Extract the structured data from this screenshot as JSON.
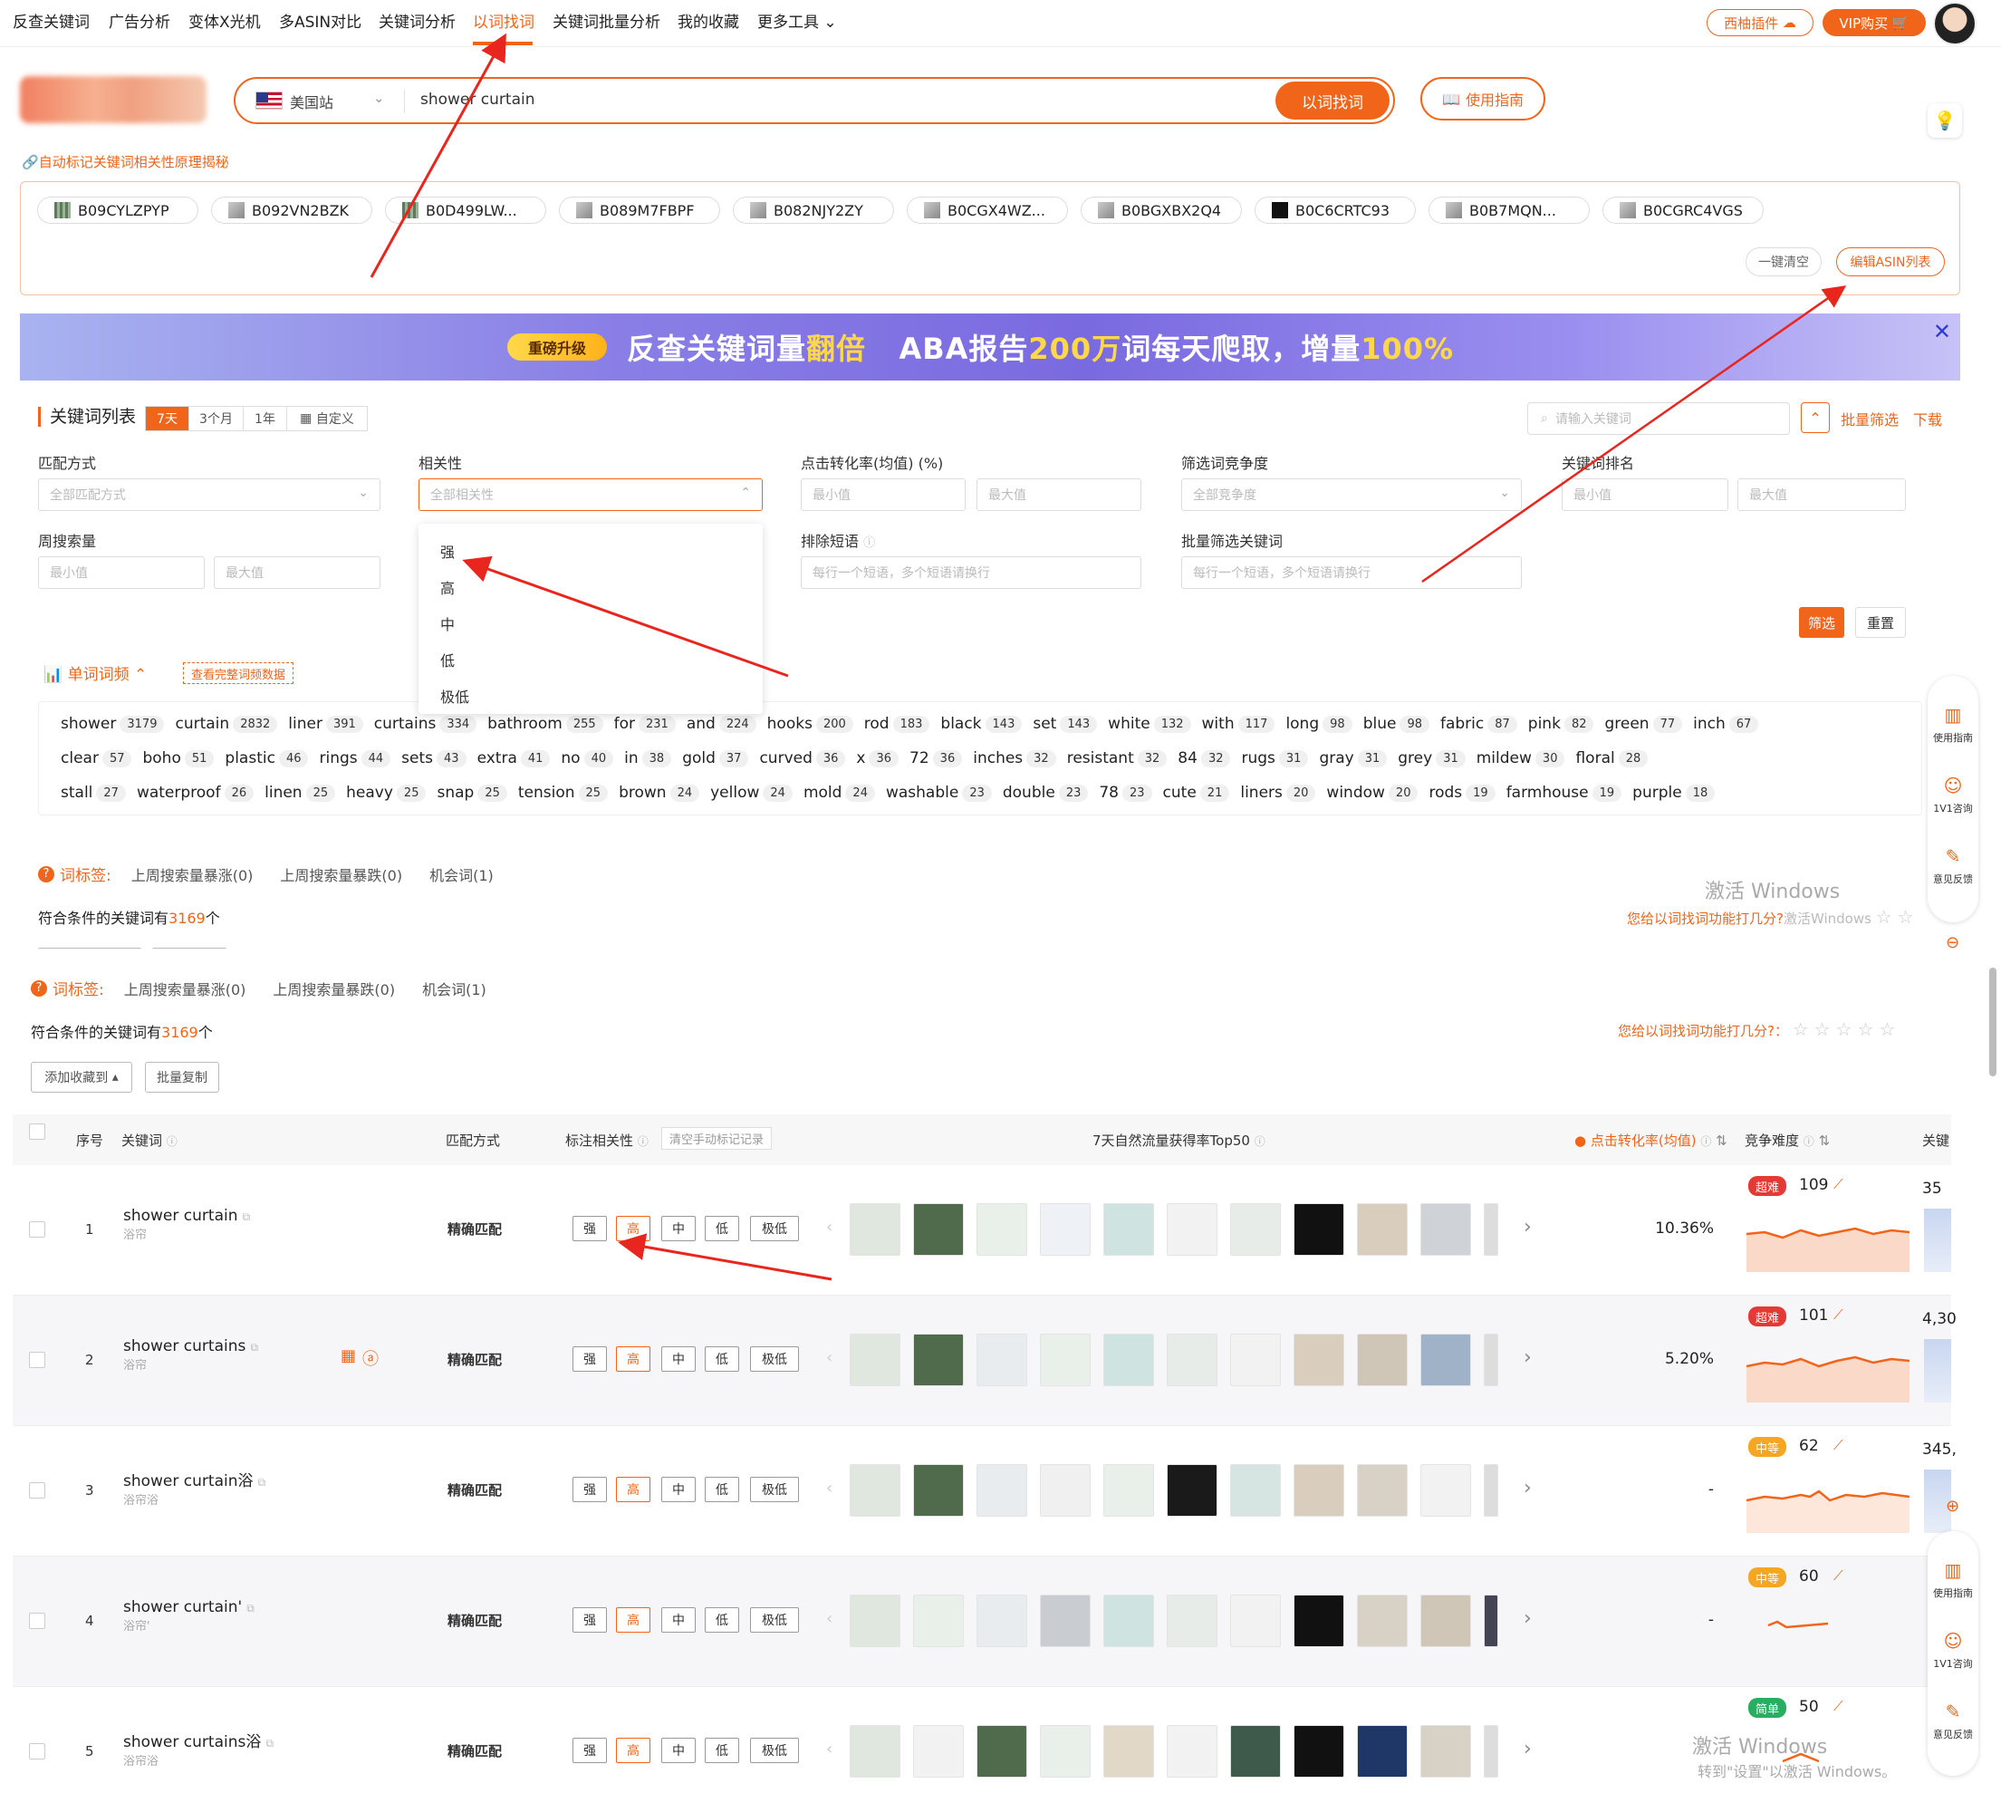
{
  "nav": {
    "items": [
      "反查关键词",
      "广告分析",
      "变体X光机",
      "多ASIN对比",
      "关键词分析",
      "以词找词",
      "关键词批量分析",
      "我的收藏",
      "更多工具"
    ],
    "active": "以词找词",
    "plugin_btn": "西柚插件",
    "vip_btn": "VIP购买"
  },
  "search": {
    "site": "美国站",
    "query": "shower curtain",
    "submit": "以词找词",
    "guide": "使用指南"
  },
  "auto_link": "自动标记关键词相关性原理揭秘",
  "asins": [
    "B09CYLZPYP",
    "B092VN2BZK",
    "B0D499LW...",
    "B089M7FBPF",
    "B082NJY2ZY",
    "B0CGX4WZ...",
    "B0BGXBX2Q4",
    "B0C6CRTC93",
    "B0B7MQN...",
    "B0CGRC4VGS"
  ],
  "asin_actions": {
    "clear": "一键清空",
    "edit": "编辑ASIN列表"
  },
  "banner": {
    "tag": "重磅升级",
    "text1": "反查关键词量",
    "text_hl1": "翻倍",
    "text2": "ABA报告",
    "text_hl2": "200万",
    "text3": "词每天爬取，增量",
    "text_hl3": "100%"
  },
  "kw_list": {
    "title": "关键词列表",
    "ranges": [
      "7天",
      "3个月",
      "1年",
      "自定义"
    ],
    "active_range": "7天",
    "search_placeholder": "请输入关键词",
    "batch_filter": "批量筛选",
    "download": "下载"
  },
  "filters": {
    "match": {
      "label": "匹配方式",
      "placeholder": "全部匹配方式"
    },
    "relevance": {
      "label": "相关性",
      "placeholder": "全部相关性",
      "options": [
        "强",
        "高",
        "中",
        "低",
        "极低"
      ]
    },
    "ctr": {
      "label": "点击转化率(均值) (%)",
      "min": "最小值",
      "max": "最大值"
    },
    "competition": {
      "label": "筛选词竞争度",
      "placeholder": "全部竞争度"
    },
    "rank": {
      "label": "关键词排名",
      "min": "最小值",
      "max": "最大值"
    },
    "weekly": {
      "label": "周搜索量",
      "min": "最小值",
      "max": "最大值"
    },
    "exclude": {
      "label": "排除短语",
      "placeholder": "每行一个短语，多个短语请换行"
    },
    "batch_kw": {
      "label": "批量筛选关键词",
      "placeholder": "每行一个短语，多个短语请换行"
    },
    "submit": "筛选",
    "reset": "重置"
  },
  "word_freq": {
    "title": "单词词频",
    "link": "查看完整词频数据",
    "rows": [
      [
        [
          "shower",
          3179
        ],
        [
          "curtain",
          2832
        ],
        [
          "liner",
          391
        ],
        [
          "curtains",
          334
        ],
        [
          "bathroom",
          255
        ],
        [
          "for",
          231
        ],
        [
          "and",
          224
        ],
        [
          "hooks",
          200
        ],
        [
          "rod",
          183
        ],
        [
          "black",
          143
        ],
        [
          "set",
          143
        ],
        [
          "white",
          132
        ],
        [
          "with",
          117
        ],
        [
          "long",
          98
        ],
        [
          "blue",
          98
        ],
        [
          "fabric",
          87
        ],
        [
          "pink",
          82
        ],
        [
          "green",
          77
        ],
        [
          "inch",
          67
        ]
      ],
      [
        [
          "clear",
          57
        ],
        [
          "boho",
          51
        ],
        [
          "plastic",
          46
        ],
        [
          "rings",
          44
        ],
        [
          "sets",
          43
        ],
        [
          "extra",
          41
        ],
        [
          "no",
          40
        ],
        [
          "in",
          38
        ],
        [
          "gold",
          37
        ],
        [
          "curved",
          36
        ],
        [
          "x",
          36
        ],
        [
          "72",
          36
        ],
        [
          "inches",
          32
        ],
        [
          "resistant",
          32
        ],
        [
          "84",
          32
        ],
        [
          "rugs",
          31
        ],
        [
          "gray",
          31
        ],
        [
          "grey",
          31
        ],
        [
          "mildew",
          30
        ],
        [
          "floral",
          28
        ]
      ],
      [
        [
          "stall",
          27
        ],
        [
          "waterproof",
          26
        ],
        [
          "linen",
          25
        ],
        [
          "heavy",
          25
        ],
        [
          "snap",
          25
        ],
        [
          "tension",
          25
        ],
        [
          "brown",
          24
        ],
        [
          "yellow",
          24
        ],
        [
          "mold",
          24
        ],
        [
          "washable",
          23
        ],
        [
          "double",
          23
        ],
        [
          "78",
          23
        ],
        [
          "cute",
          21
        ],
        [
          "liners",
          20
        ],
        [
          "window",
          20
        ],
        [
          "rods",
          19
        ],
        [
          "farmhouse",
          19
        ],
        [
          "purple",
          18
        ]
      ]
    ]
  },
  "tags": {
    "head": "词标签:",
    "items": [
      "上周搜索量暴涨(0)",
      "上周搜索量暴跌(0)",
      "机会词(1)"
    ]
  },
  "count": {
    "prefix": "符合条件的关键词有",
    "num": "3169",
    "suffix": "个"
  },
  "rating": "您给以词找词功能打几分?：",
  "rating_top": "您给以词找词功能打几分?",
  "watermark": {
    "line1": "激活 Windows",
    "line2": "转到\"设置\"以激活 Windows。",
    "overlap_tail": "激活Windows"
  },
  "toolbar": {
    "add_fav": "添加收藏到",
    "batch_copy": "批量复制"
  },
  "table": {
    "headers": {
      "no": "序号",
      "keyword": "关键词",
      "match": "匹配方式",
      "relevance": "标注相关性",
      "clear_manual": "清空手动标记记录",
      "top50": "7天自然流量获得率Top50",
      "ctr": "点击转化率(均值)",
      "difficulty": "竞争难度",
      "last": "关键"
    },
    "rel_options": [
      "强",
      "高",
      "中",
      "低",
      "极低"
    ],
    "rows": [
      {
        "no": "1",
        "kw": "shower curtain",
        "cn": "浴帘",
        "match": "精确匹配",
        "rel": "高",
        "rate": "10.36%",
        "badge": "超难",
        "badge_color": "#e53935",
        "diff": "109",
        "last": "35"
      },
      {
        "no": "2",
        "kw": "shower curtains",
        "cn": "浴帘",
        "match": "精确匹配",
        "rel": "高",
        "rate": "5.20%",
        "badge": "超难",
        "badge_color": "#e53935",
        "diff": "101",
        "last": "4,30"
      },
      {
        "no": "3",
        "kw": "shower curtain浴",
        "cn": "浴帘浴",
        "match": "精确匹配",
        "rel": "高",
        "rate": "-",
        "badge": "中等",
        "badge_color": "#f5a623",
        "diff": "62",
        "last": "345,"
      },
      {
        "no": "4",
        "kw": "shower curtain'",
        "cn": "浴帘'",
        "match": "精确匹配",
        "rel": "高",
        "rate": "-",
        "badge": "中等",
        "badge_color": "#f5a623",
        "diff": "60",
        "last": ""
      },
      {
        "no": "5",
        "kw": "shower curtains浴",
        "cn": "浴帘浴",
        "match": "精确匹配",
        "rel": "高",
        "rate": "",
        "badge": "简单",
        "badge_color": "#27ae60",
        "diff": "50",
        "last": ""
      }
    ]
  },
  "side": {
    "guide": "使用指南",
    "consult": "1V1咨询",
    "feedback": "意见反馈"
  }
}
